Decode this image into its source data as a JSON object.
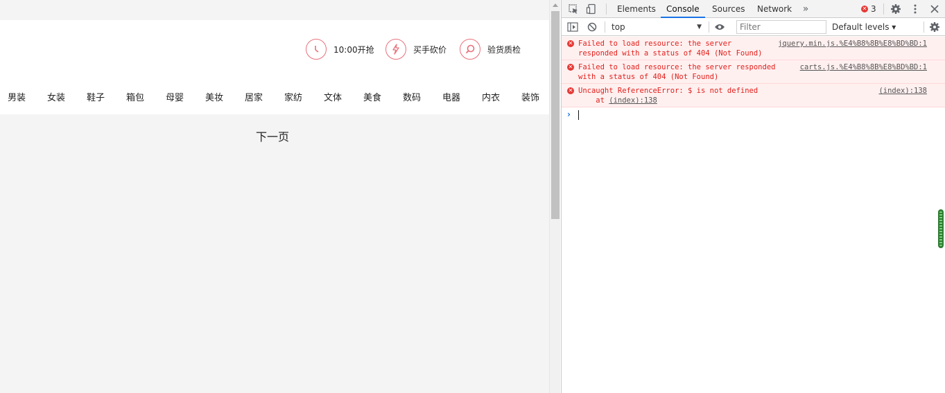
{
  "page": {
    "features": [
      {
        "label": "10:00开抢",
        "icon": "clock-icon"
      },
      {
        "label": "买手砍价",
        "icon": "lightning-icon"
      },
      {
        "label": "验货质检",
        "icon": "search-icon"
      }
    ],
    "nav_items": [
      "男装",
      "女装",
      "鞋子",
      "箱包",
      "母婴",
      "美妆",
      "居家",
      "家纺",
      "文体",
      "美食",
      "数码",
      "电器",
      "内衣",
      "装饰"
    ],
    "next_page": "下一页",
    "accent_color": "#e8707a"
  },
  "devtools": {
    "tabs": [
      "Elements",
      "Console",
      "Sources",
      "Network"
    ],
    "active_tab": "Console",
    "more_tabs_glyph": "»",
    "error_count": "3",
    "context": "top",
    "filter_placeholder": "Filter",
    "levels": "Default levels ▾",
    "messages": [
      {
        "line1": "Failed to load resource: the server",
        "line2": "responded with a status of 404 (Not Found)",
        "source": "jquery.min.js.%E4%B8%8B%E8%BD%BD:1"
      },
      {
        "line1": "Failed to load resource: the server responded",
        "line2": "with a status of 404 (Not Found)",
        "source": "carts.js.%E4%B8%8B%E8%BD%BD:1"
      },
      {
        "line1": "Uncaught ReferenceError: $ is not defined",
        "line2_prefix": "    at ",
        "line2_link": "(index):138",
        "source": "(index):138"
      }
    ],
    "error_color": "#e0201b",
    "accent_color": "#1a73e8"
  }
}
